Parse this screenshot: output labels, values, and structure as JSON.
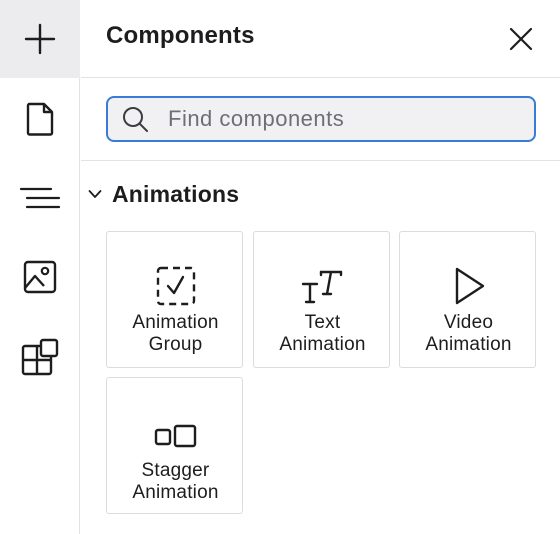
{
  "panel": {
    "title": "Components",
    "search": {
      "placeholder": "Find components",
      "value": ""
    }
  },
  "rail": {
    "items": [
      {
        "icon": "plus-icon",
        "active": true
      },
      {
        "icon": "page-icon",
        "active": false
      },
      {
        "icon": "navigator-lines-icon",
        "active": false
      },
      {
        "icon": "image-icon",
        "active": false
      },
      {
        "icon": "components-grid-icon",
        "active": false
      }
    ]
  },
  "section": {
    "title": "Animations",
    "expanded": true,
    "tiles": [
      {
        "line1": "Animation",
        "line2": "Group",
        "icon": "animation-group-icon"
      },
      {
        "line1": "Text",
        "line2": "Animation",
        "icon": "text-animation-icon"
      },
      {
        "line1": "Video",
        "line2": "Animation",
        "icon": "video-play-icon"
      },
      {
        "line1": "Stagger",
        "line2": "Animation",
        "icon": "stagger-animation-icon"
      }
    ]
  },
  "colors": {
    "accent": "#3a7bd5",
    "rail_active": "#ececef",
    "border": "#dcdce0",
    "search_bg": "#f1f1f3"
  }
}
